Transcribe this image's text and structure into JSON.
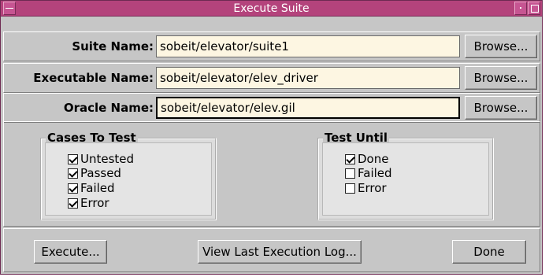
{
  "window": {
    "title": "Execute Suite",
    "accent_color": "#b4437c",
    "titlebar_icons": [
      "menu-icon",
      "minimize-icon",
      "maximize-icon"
    ]
  },
  "fields": [
    {
      "label": "Suite Name:",
      "value": "sobeit/elevator/suite1",
      "browse_label": "Browse..."
    },
    {
      "label": "Executable Name:",
      "value": "sobeit/elevator/elev_driver",
      "browse_label": "Browse..."
    },
    {
      "label": "Oracle Name:",
      "value": "sobeit/elevator/elev.gil",
      "browse_label": "Browse..."
    }
  ],
  "cases_to_test": {
    "title": "Cases To Test",
    "options": [
      {
        "label": "Untested",
        "checked": true
      },
      {
        "label": "Passed",
        "checked": true
      },
      {
        "label": "Failed",
        "checked": true
      },
      {
        "label": "Error",
        "checked": true
      }
    ]
  },
  "test_until": {
    "title": "Test Until",
    "options": [
      {
        "label": "Done",
        "checked": true
      },
      {
        "label": "Failed",
        "checked": false
      },
      {
        "label": "Error",
        "checked": false
      }
    ]
  },
  "actions": {
    "execute_label": "Execute...",
    "view_log_label": "View Last Execution Log...",
    "done_label": "Done"
  }
}
